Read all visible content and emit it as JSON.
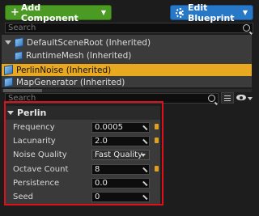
{
  "toolbar": {
    "add_component_label": "Add Component",
    "edit_blueprint_label": "Edit Blueprint"
  },
  "components_search": {
    "placeholder": "Search"
  },
  "component_tree": [
    {
      "label": "DefaultSceneRoot (Inherited)",
      "selected": false
    },
    {
      "label": "RuntimeMesh (Inherited)",
      "selected": false
    },
    {
      "label": "PerlinNoise (Inherited)",
      "selected": true
    },
    {
      "label": "MapGenerator (Inherited)",
      "selected": false
    }
  ],
  "details_search": {
    "placeholder": "Search"
  },
  "details": {
    "section_title": "Perlin",
    "properties": [
      {
        "label": "Frequency",
        "value": "0.0005"
      },
      {
        "label": "Lacunarity",
        "value": "2.0"
      },
      {
        "label": "Noise Quality",
        "value": "Fast Quality"
      },
      {
        "label": "Octave Count",
        "value": "8"
      },
      {
        "label": "Persistence",
        "value": "0.0"
      },
      {
        "label": "Seed",
        "value": "0"
      }
    ]
  },
  "colors": {
    "add_button": "#4a9a24",
    "edit_button": "#2878c8",
    "selection": "#e8a820",
    "highlight_box": "#e0101a"
  }
}
